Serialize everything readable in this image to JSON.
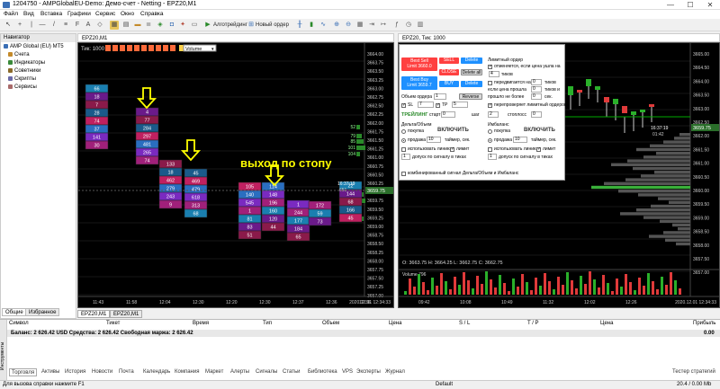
{
  "window": {
    "title": "1204750 - AMPGlobalEU-Demo: Демо-счет - Netting - EPZ20,M1",
    "minimize": "—",
    "maximize": "☐",
    "close": "✕"
  },
  "menu": [
    "Файл",
    "Вид",
    "Вставка",
    "Графики",
    "Сервис",
    "Окно",
    "Справка"
  ],
  "toolbar": {
    "algo_label": "Алготрейдинг",
    "new_order_label": "Новый ордер"
  },
  "navigator": {
    "title": "Навигатор",
    "items": [
      "AMP Global (EU) MT5",
      "Счета",
      "Индикаторы",
      "Советники",
      "Скрипты",
      "Сервисы"
    ],
    "tabs": [
      "Общие",
      "Избранное"
    ]
  },
  "chart1": {
    "window_title": "EPZ20,M1",
    "toolbar_label": "Тик: 1000",
    "volume_select": "Volume",
    "annotation": "выход по стопу",
    "price_ticks": [
      "3664.00",
      "3663.75",
      "3663.50",
      "3663.25",
      "3663.00",
      "3662.75",
      "3662.50",
      "3662.25",
      "3662.00",
      "3661.75",
      "3661.50",
      "3661.25",
      "3661.00",
      "3660.75",
      "3660.50",
      "3660.25",
      "3660.00",
      "3659.75",
      "3659.50",
      "3659.25",
      "3659.00",
      "3658.75",
      "3658.50",
      "3658.25",
      "3658.00",
      "3657.75",
      "3657.50",
      "3657.25",
      "3657.00"
    ],
    "side_values": [
      "52",
      "79",
      "85",
      "101",
      "104",
      "17",
      "151",
      "104",
      "114",
      "18",
      "11"
    ],
    "time_ticks": [
      "11:43",
      "11:58",
      "12:04",
      "12:30",
      "12:20",
      "12:30",
      "12:37",
      "12:36",
      "12:36"
    ],
    "time_label": "2020.12.01 12:34:33",
    "clock": "16:37:19",
    "clock_sub": "651",
    "current_price": "3659.75",
    "columns": [
      {
        "cells": [
          "66",
          "18",
          "7",
          "28",
          "74",
          "37",
          "141",
          "30"
        ]
      },
      {
        "cells": [
          "4",
          "77",
          "284",
          "297",
          "481",
          "265",
          "74"
        ]
      },
      {
        "cells": [
          "133",
          "18",
          "462",
          "279",
          "243",
          "9"
        ]
      },
      {
        "cells": [
          "45",
          "469",
          "479",
          "618",
          "313",
          "68"
        ]
      },
      {
        "cells": [
          "105",
          "140",
          "545",
          "1",
          "81",
          "83",
          "51"
        ]
      },
      {
        "cells": [
          "114",
          "148",
          "196",
          "160",
          "120",
          "44"
        ]
      },
      {
        "cells": [
          "1",
          "244",
          "177",
          "184",
          "65"
        ]
      },
      {
        "cells": [
          "172",
          "59",
          "73"
        ]
      },
      {
        "cells": [
          "22",
          "144",
          "68",
          "166",
          "45"
        ]
      }
    ]
  },
  "chart2": {
    "window_title": "EPZ20, Тик: 1000",
    "ohlc": "O: 3663.75  H: 3664.25  L: 3662.75  C: 3662.75",
    "price_ticks": [
      "3665.00",
      "3664.50",
      "3664.00",
      "3663.50",
      "3663.00",
      "3662.50",
      "3662.00",
      "3661.50",
      "3661.00",
      "3660.50",
      "3660.00",
      "3659.50",
      "3659.00",
      "3658.50",
      "3658.00",
      "3657.50",
      "3657.00"
    ],
    "current_price": "3659.75",
    "clock": "16:37:19",
    "clock_sub": "01:42",
    "volume_label": "Volume 796",
    "time_ticks": [
      "09:42",
      "10:08",
      "10:49",
      "11:32",
      "12:02",
      "12:26"
    ],
    "time_label": "2020.12.01 12:34:33"
  },
  "panel": {
    "best_sell": "Best Sell\nLimit 3660.0",
    "sell": "SELL",
    "delete1": "Delete",
    "close": "CLOSE",
    "delete_all": "Delete all",
    "best_buy": "Best Buy\nLimit 3659.7",
    "buy": "BUY",
    "delete2": "Delete",
    "limit_order": "Лимитный ордер",
    "cancel_label": "отменяется, если цена ушла на",
    "cancel_value": "4",
    "ticks": "тиков",
    "move_label": "передвигается на",
    "move_value": "0",
    "move_ticks": "тиков",
    "if_price_label": "если цена прошла",
    "if_price_value": "0",
    "and_label": "тиков и",
    "passed_label": "прошло не более",
    "passed_value": "0",
    "sec": "сек.",
    "volume_label": "Объем ордера",
    "volume_value": "1",
    "reverse": "Reverse",
    "sl_label": "SL",
    "sl_value": "7",
    "tp_label": "TP",
    "tp_value": "5",
    "reposition": "перепроверяет лимитный ордеров",
    "trailing_label": "ТРЕЙЛИНГ",
    "start_label": "старт",
    "start_value": "0",
    "step_label": "шаг",
    "step_value": "2",
    "stoploss_label": "стоплосс",
    "stoploss_value": "0",
    "delta_header": "Дельта/Объем",
    "imbalance_header": "Имбаланс",
    "buy_radio": "покупка",
    "sell_radio": "продажа",
    "enable": "ВКЛЮЧИТЬ",
    "enable2": "ВКЛЮЧИТЬ",
    "delta_sell_value": "10",
    "timer_label": "таймер, сек.",
    "use_line": "использовать линию",
    "limit_chk": "лимит",
    "tolerance_label": "допуск по сигналу в тиках",
    "delta_tol_value": "1",
    "imb_sell_value": "10",
    "imb_tol_value": "1",
    "combined": "комбинированный сигнал Дельта/Объем и Имбаланс"
  },
  "chart_tabs": [
    "EPZ20,M1",
    "EPZ20,M1"
  ],
  "terminal": {
    "columns": [
      "Символ",
      "Тикет",
      "Время",
      "Тип",
      "Объем",
      "Цена",
      "S / L",
      "T / P",
      "Цена",
      "Прибыль"
    ],
    "balance_row": "Баланс: 2 626.42 USD  Средства: 2 626.42  Свободная маржа: 2 626.42",
    "balance_profit": "0.00",
    "tabs": [
      "Торговля",
      "Активы",
      "История",
      "Новости",
      "Почта",
      "Календарь",
      "Компания",
      "Маркет",
      "Алерты",
      "Сигналы",
      "Статьи",
      "Библиотека",
      "VPS",
      "Эксперты",
      "Журнал"
    ],
    "strategy_tester": "Тестер стратегий",
    "side_label": "Инструменты"
  },
  "status": {
    "help": "Для вызова справки нажмите F1",
    "profile": "Default",
    "traffic": "20.4 / 0.00 Mb"
  },
  "colors": {
    "chart_bg": "#000000",
    "grid": "#1e1e1e",
    "price_tag": "#2a6e2a",
    "annotation": "#ffff00",
    "buy_btn": "#1e90ff",
    "sell_btn": "#ff4040"
  }
}
